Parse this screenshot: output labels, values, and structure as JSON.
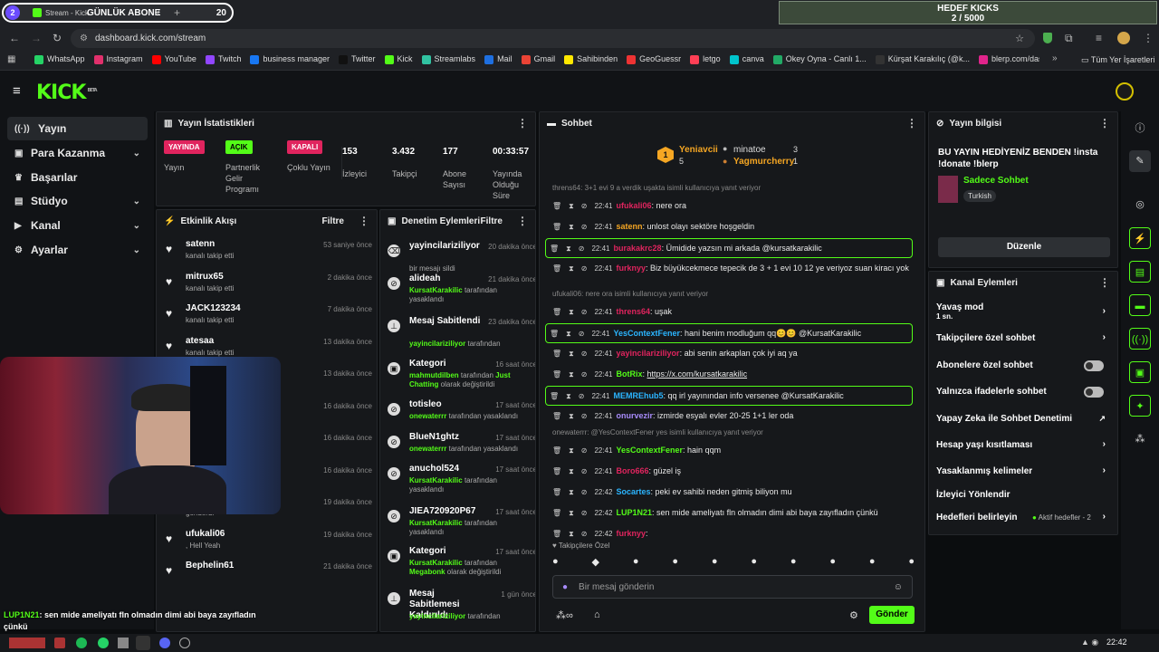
{
  "browser": {
    "profile_num": "2",
    "tab_title": "Stream - Kick",
    "tab_overlay": "GÜNLÜK ABONE",
    "overlay_count": "20",
    "url": "dashboard.kick.com/stream"
  },
  "goal": {
    "title": "HEDEF KICKS",
    "count": "2 / 5000"
  },
  "bookmarks": [
    {
      "label": "WhatsApp",
      "color": "#25d366"
    },
    {
      "label": "Instagram",
      "color": "#e1306c"
    },
    {
      "label": "YouTube",
      "color": "#ff0000"
    },
    {
      "label": "Twitch",
      "color": "#9146ff"
    },
    {
      "label": "business manager",
      "color": "#1877f2"
    },
    {
      "label": "Twitter",
      "color": "#111111"
    },
    {
      "label": "Kick",
      "color": "#53fc18"
    },
    {
      "label": "Streamlabs",
      "color": "#31c3a2"
    },
    {
      "label": "Mail",
      "color": "#1e6fe0"
    },
    {
      "label": "Gmail",
      "color": "#ea4335"
    },
    {
      "label": "Sahibinden",
      "color": "#ffe800"
    },
    {
      "label": "GeoGuessr",
      "color": "#e33"
    },
    {
      "label": "letgo",
      "color": "#ff3f55"
    },
    {
      "label": "canva",
      "color": "#00c4cc"
    },
    {
      "label": "Okey Oyna - Canlı 1...",
      "color": "#2a6"
    },
    {
      "label": "Kürşat Karakılıç (@k...",
      "color": "#333"
    },
    {
      "label": "blerp.com/dashboar...",
      "color": "#e0248b"
    }
  ],
  "bookmarks_all": "Tüm Yer İşaretleri",
  "sidebar": {
    "items": [
      {
        "label": "Yayın",
        "icon": "broadcast-icon"
      },
      {
        "label": "Para Kazanma",
        "icon": "money-icon"
      },
      {
        "label": "Başarılar",
        "icon": "trophy-icon"
      },
      {
        "label": "Stüdyo",
        "icon": "studio-icon"
      },
      {
        "label": "Kanal",
        "icon": "channel-icon"
      },
      {
        "label": "Ayarlar",
        "icon": "settings-icon"
      }
    ]
  },
  "stats": {
    "title": "Yayın İstatistikleri",
    "yayinda": "YAYINDA",
    "yayin": "Yayın",
    "acik": "AÇIK",
    "partnerlik": "Partnerlik Gelir Programı",
    "kapali": "KAPALI",
    "coklu": "Çoklu Yayın",
    "izleyici_val": "153",
    "izleyici": "İzleyici",
    "takipci_val": "3.432",
    "takipci": "Takipçi",
    "abone_val": "177",
    "abone": "Abone Sayısı",
    "sure_val": "00:33:57",
    "sure": "Yayında Olduğu Süre"
  },
  "activity": {
    "title": "Etkinlik Akışı",
    "filter": "Filtre",
    "items": [
      {
        "name": "satenn",
        "sub": "kanalı takip etti",
        "time": "53 saniye önce"
      },
      {
        "name": "mitrux65",
        "sub": "kanalı takip etti",
        "time": "2 dakika önce"
      },
      {
        "name": "JACK123234",
        "sub": "kanalı takip etti",
        "time": "7 dakika önce"
      },
      {
        "name": "atesaa",
        "sub": "kanalı takip etti",
        "time": "13 dakika önce"
      },
      {
        "name": "",
        "sub": "",
        "time": "13 dakika önce"
      },
      {
        "name": "",
        "sub": "",
        "time": "16 dakika önce"
      },
      {
        "name": "",
        "sub": "",
        "time": "16 dakika önce"
      },
      {
        "name": "",
        "sub": "",
        "time": "16 dakika önce"
      },
      {
        "name": ", Hell Yeah",
        "sub": "gönderdi",
        "time": "19 dakika önce"
      },
      {
        "name": "ufukali06",
        "sub": ", Hell Yeah",
        "time": "19 dakika önce"
      },
      {
        "name": "Bephelin61",
        "sub": "",
        "time": "21 dakika önce"
      }
    ],
    "gift_count": "1",
    "gift_sub": "gönderdi"
  },
  "moderation": {
    "title": "Denetim Eylemleri",
    "filter": "Filtre",
    "items": [
      {
        "name": "yayincilariziliyor",
        "time": "20 dakika önce",
        "sub": "bir mesajı sildi"
      },
      {
        "name": "alideah",
        "time": "21 dakika önce",
        "by": "KursatKarakilic",
        "sub": "tarafından yasaklandı"
      },
      {
        "name": "Mesaj Sabitlendi",
        "time": "23 dakika önce",
        "by": "yayincilariziliyor",
        "sub": "tarafından"
      },
      {
        "name": "Kategori",
        "time": "16 saat önce",
        "by": "mahmutdilben",
        "sub": "tarafından",
        "extra": "Just Chatting",
        "sub2": "olarak değiştirildi"
      },
      {
        "name": "totisleo",
        "time": "17 saat önce",
        "by": "onewaterrr",
        "sub": "tarafından yasaklandı"
      },
      {
        "name": "BlueN1ghtz",
        "time": "17 saat önce",
        "by": "onewaterrr",
        "sub": "tarafından yasaklandı"
      },
      {
        "name": "anuchol524",
        "time": "17 saat önce",
        "by": "KursatKarakilic",
        "sub": "tarafından yasaklandı"
      },
      {
        "name": "JIEA720920P67",
        "time": "17 saat önce",
        "by": "KursatKarakilic",
        "sub": "tarafından yasaklandı"
      },
      {
        "name": "Kategori",
        "time": "17 saat önce",
        "by": "KursatKarakilic",
        "sub": "tarafından",
        "extra": "Megabonk",
        "sub2": "olarak değiştirildi"
      },
      {
        "name": "Mesaj Sabitlemesi Kaldırıldı",
        "time": "1 gün önce",
        "by": "yayincilariziliyor",
        "sub": "tarafından"
      }
    ]
  },
  "chat": {
    "title": "Sohbet",
    "leaders": {
      "first": "Yeniavcii",
      "first_count": "5",
      "second": "minatoe",
      "second_count": "3",
      "third": "Yagmurcherry",
      "third_count": "1",
      "rank": "1"
    },
    "messages": [
      {
        "type": "sys",
        "text": "threns64: 3+1 evi 9 a verdik uşakta isimli kullanıcıya yanıt veriyor"
      },
      {
        "time": "22:41",
        "user": "ufukali06",
        "color": "#e0245e",
        "text": ": nere ora"
      },
      {
        "time": "22:41",
        "user": "satenn",
        "color": "#f5a623",
        "text": ": unlost olayı sektöre hoşgeldin"
      },
      {
        "time": "22:41",
        "user": "burakakrc28",
        "color": "#e0245e",
        "text": ": Ümidide yazsın mi arkada @kursatkarakilic",
        "hl": true
      },
      {
        "time": "22:41",
        "user": "furknyy",
        "color": "#e0245e",
        "text": ": Biz büyükcekmece tepecik de 3 + 1 evi 10 12 ye veriyoz suan kiracı yok",
        "tall": true
      },
      {
        "type": "sys",
        "text": "ufukali06: nere ora isimli kullanıcıya yanıt veriyor"
      },
      {
        "time": "22:41",
        "user": "threns64",
        "color": "#e0245e",
        "text": ": uşak"
      },
      {
        "time": "22:41",
        "user": "YesContextFener",
        "color": "#2bb5ff",
        "text": ": hani benim modluğum qq😊😊 @KursatKarakilic",
        "hl": true
      },
      {
        "time": "22:41",
        "user": "yayincilariziliyor",
        "color": "#e0245e",
        "text": ": abi senin arkaplan çok iyi aq ya"
      },
      {
        "time": "22:41",
        "user": "BotRix",
        "color": "#53fc18",
        "text": ": ",
        "link": "https://x.com/kursatkarakilic"
      },
      {
        "time": "22:41",
        "user": "MEMREhub5",
        "color": "#2bb5ff",
        "text": ": qq irl yayınından info versenee @KursatKarakilic",
        "hl": true
      },
      {
        "time": "22:41",
        "user": "onurvezir",
        "color": "#a78bfa",
        "text": ": izmirde esyalı evler 20-25 1+1 ler oda"
      },
      {
        "type": "sys",
        "text": "onewaterrr: @YesContextFener yes isimli kullanıcıya yanıt veriyor"
      },
      {
        "time": "22:41",
        "user": "YesContextFener",
        "color": "#53fc18",
        "text": ": hain qqm"
      },
      {
        "time": "22:41",
        "user": "Boro666",
        "color": "#e0245e",
        "text": ": güzel iş"
      },
      {
        "time": "22:42",
        "user": "Socartes",
        "color": "#2bb5ff",
        "text": ": peki ev sahibi neden gitmiş biliyon mu"
      },
      {
        "time": "22:42",
        "user": "LUP1N21",
        "color": "#53fc18",
        "text": ": sen mide ameliyatı fln olmadın dimi abi baya zayıfladın çünkü"
      },
      {
        "time": "22:42",
        "user": "furknyy",
        "color": "#e0245e",
        "text": ": "
      }
    ],
    "follower_mode": "Takipçilere Özel",
    "placeholder": "Bir mesaj gönderin",
    "send": "Gönder"
  },
  "info": {
    "title": "Yayın bilgisi",
    "stream_title": "BU YAYIN HEDİYENİZ BENDEN !insta !donate !blerp",
    "category": "Sadece Sohbet",
    "lang": "Turkish",
    "edit": "Düzenle"
  },
  "channel": {
    "title": "Kanal Eylemleri",
    "slow": "Yavaş mod",
    "slow_val": "1 sn.",
    "followers": "Takipçilere özel sohbet",
    "subs": "Abonelere özel sohbet",
    "emotes": "Yalnızca ifadelerle sohbet",
    "ai": "Yapay Zeka ile Sohbet Denetimi",
    "age": "Hesap yaşı kısıtlaması",
    "banned": "Yasaklanmış kelimeler",
    "raid": "İzleyici Yönlendir",
    "goals": "Hedefleri belirleyin",
    "goals_val": "Aktif hedefler - 2"
  },
  "overlay_chat": {
    "user": "LUP1N21",
    "text": ": sen mide ameliyatı fln olmadın dimi abi baya zayıfladın çünkü"
  },
  "taskbar": {
    "clock": "22:42"
  },
  "colors": {
    "accent": "#53fc18",
    "live": "#e0245e"
  }
}
